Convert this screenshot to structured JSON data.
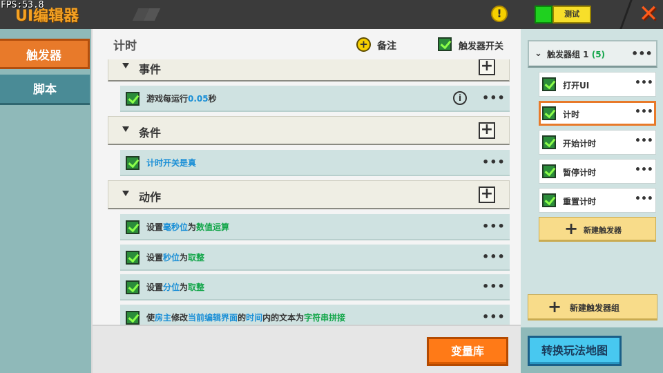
{
  "fps": "FPS:53.8",
  "app_title": "UI编辑器",
  "top_bar": {
    "test_label": "测试",
    "warning_glyph": "!",
    "close_glyph": "✕"
  },
  "left_nav": {
    "items": [
      {
        "label": "触发器",
        "active": true
      },
      {
        "label": "脚本",
        "active": false
      }
    ]
  },
  "main": {
    "title": "计时",
    "note_label": "备注",
    "trigger_toggle_label": "触发器开关",
    "sections": {
      "events": {
        "label": "事件",
        "rows": [
          {
            "parts": [
              {
                "t": "游戏每运行",
                "c": ""
              },
              {
                "t": "0.05",
                "c": "blue"
              },
              {
                "t": "秒",
                "c": ""
              }
            ]
          }
        ]
      },
      "conditions": {
        "label": "条件",
        "rows": [
          {
            "parts": [
              {
                "t": "计时开关是真",
                "c": "blue"
              }
            ]
          }
        ]
      },
      "actions": {
        "label": "动作",
        "rows": [
          {
            "parts": [
              {
                "t": "设置",
                "c": ""
              },
              {
                "t": "毫秒位",
                "c": "blue"
              },
              {
                "t": "为",
                "c": ""
              },
              {
                "t": "数值运算",
                "c": "green"
              }
            ]
          },
          {
            "parts": [
              {
                "t": "设置",
                "c": ""
              },
              {
                "t": "秒位",
                "c": "blue"
              },
              {
                "t": "为",
                "c": ""
              },
              {
                "t": "取整",
                "c": "green"
              }
            ]
          },
          {
            "parts": [
              {
                "t": "设置",
                "c": ""
              },
              {
                "t": "分位",
                "c": "blue"
              },
              {
                "t": "为",
                "c": ""
              },
              {
                "t": "取整",
                "c": "green"
              }
            ]
          },
          {
            "parts": [
              {
                "t": "使",
                "c": ""
              },
              {
                "t": "房主",
                "c": "blue"
              },
              {
                "t": "修改",
                "c": ""
              },
              {
                "t": "当前编辑界面",
                "c": "blue"
              },
              {
                "t": "的",
                "c": ""
              },
              {
                "t": "时间",
                "c": "blue"
              },
              {
                "t": "内的文本为",
                "c": ""
              },
              {
                "t": "字符串拼接",
                "c": "green"
              }
            ]
          }
        ]
      }
    },
    "variable_library_label": "变量库"
  },
  "right_panel": {
    "group": {
      "label": "触发器组 1",
      "count": "(5)"
    },
    "triggers": [
      {
        "label": "打开UI",
        "selected": false
      },
      {
        "label": "计时",
        "selected": true
      },
      {
        "label": "开始计时",
        "selected": false
      },
      {
        "label": "暂停计时",
        "selected": false
      },
      {
        "label": "重置计时",
        "selected": false
      }
    ],
    "new_trigger_label": "新建触发器",
    "new_group_label": "新建触发器组",
    "switch_map_label": "转换玩法地图"
  },
  "colors": {
    "accent_orange": "#e87a2a",
    "teal_background": "#8fb9b9",
    "blue_text": "#1a8fd6",
    "green_text": "#13a64a",
    "map_button": "#48c8f0"
  },
  "icons": {
    "more": "•••",
    "add": "+",
    "info": "i",
    "expand": "▼",
    "collapse": "❯"
  }
}
